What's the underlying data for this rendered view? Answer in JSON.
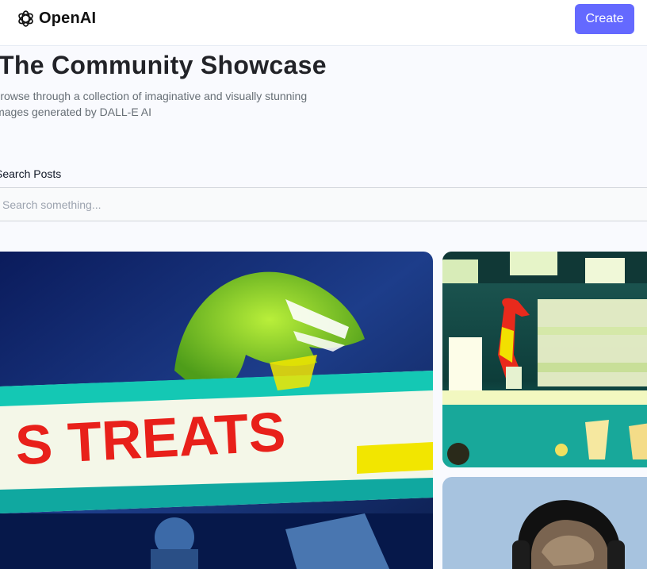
{
  "header": {
    "logo_text": "OpenAI",
    "create_label": "Create"
  },
  "hero": {
    "title": "The Community Showcase",
    "subtitle": "Browse through a collection of imaginative and visually stunning images generated by DALL-E AI"
  },
  "search": {
    "label": "Search Posts",
    "placeholder": "Search something...",
    "value": ""
  },
  "posts": [
    {
      "sign_text": "S TREATS"
    },
    {
      "sign_text": ""
    },
    {
      "sign_text": ""
    }
  ],
  "colors": {
    "accent": "#6469ff",
    "background": "#f9fafe",
    "title": "#222328",
    "subtitle": "#666e75"
  },
  "icons": {
    "logo": "openai-logo-icon"
  }
}
